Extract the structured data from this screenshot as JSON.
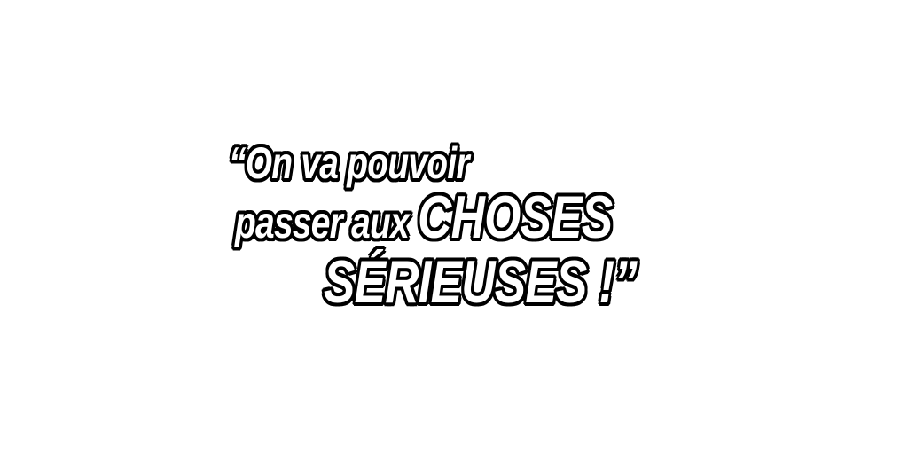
{
  "quote": {
    "line1": "“On va pouvoir",
    "line2_small": "passer aux ",
    "line2_big": "CHOSES",
    "line3": "SÉRIEUSES !”"
  },
  "colors": {
    "background": "#ffffff",
    "text_fill": "#ffffff",
    "text_outline": "#000000"
  }
}
